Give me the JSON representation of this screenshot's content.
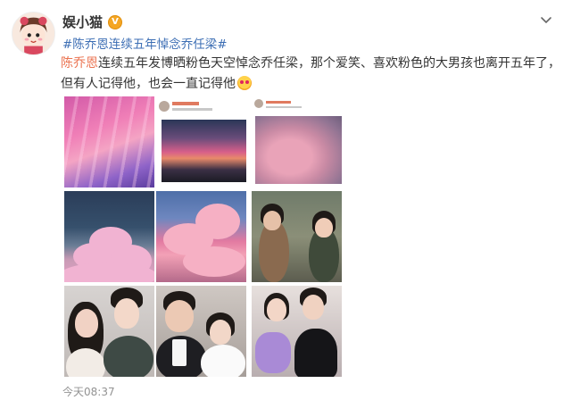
{
  "post": {
    "username": "娱小猫",
    "vip_badge": "V",
    "hashtag": "#陈乔恩连续五年悼念乔任梁#",
    "body": {
      "mention": "陈乔恩",
      "text": "连续五年发博晒粉色天空悼念乔任梁，那个爱笑、喜欢粉色的大男孩也离开五年了，但有人记得他，也会一直记得他"
    },
    "emoji": "heart-eyes-emoji",
    "timestamp": "今天08:37"
  },
  "images": [
    {
      "name": "pink-sky-rays-photo"
    },
    {
      "name": "sunset-screenshot-photo"
    },
    {
      "name": "pink-clouds-screenshot-photo"
    },
    {
      "name": "pink-clouds-night-photo"
    },
    {
      "name": "pink-clouds-blue-sky-photo"
    },
    {
      "name": "actors-outdoor-photo"
    },
    {
      "name": "couple-selfie-photo"
    },
    {
      "name": "groom-bride-photo"
    },
    {
      "name": "bouquet-costume-photo"
    }
  ],
  "colors": {
    "link": "#3c6eb4",
    "mention": "#eb7350",
    "badge": "#f5a623",
    "timestamp": "#939393"
  }
}
